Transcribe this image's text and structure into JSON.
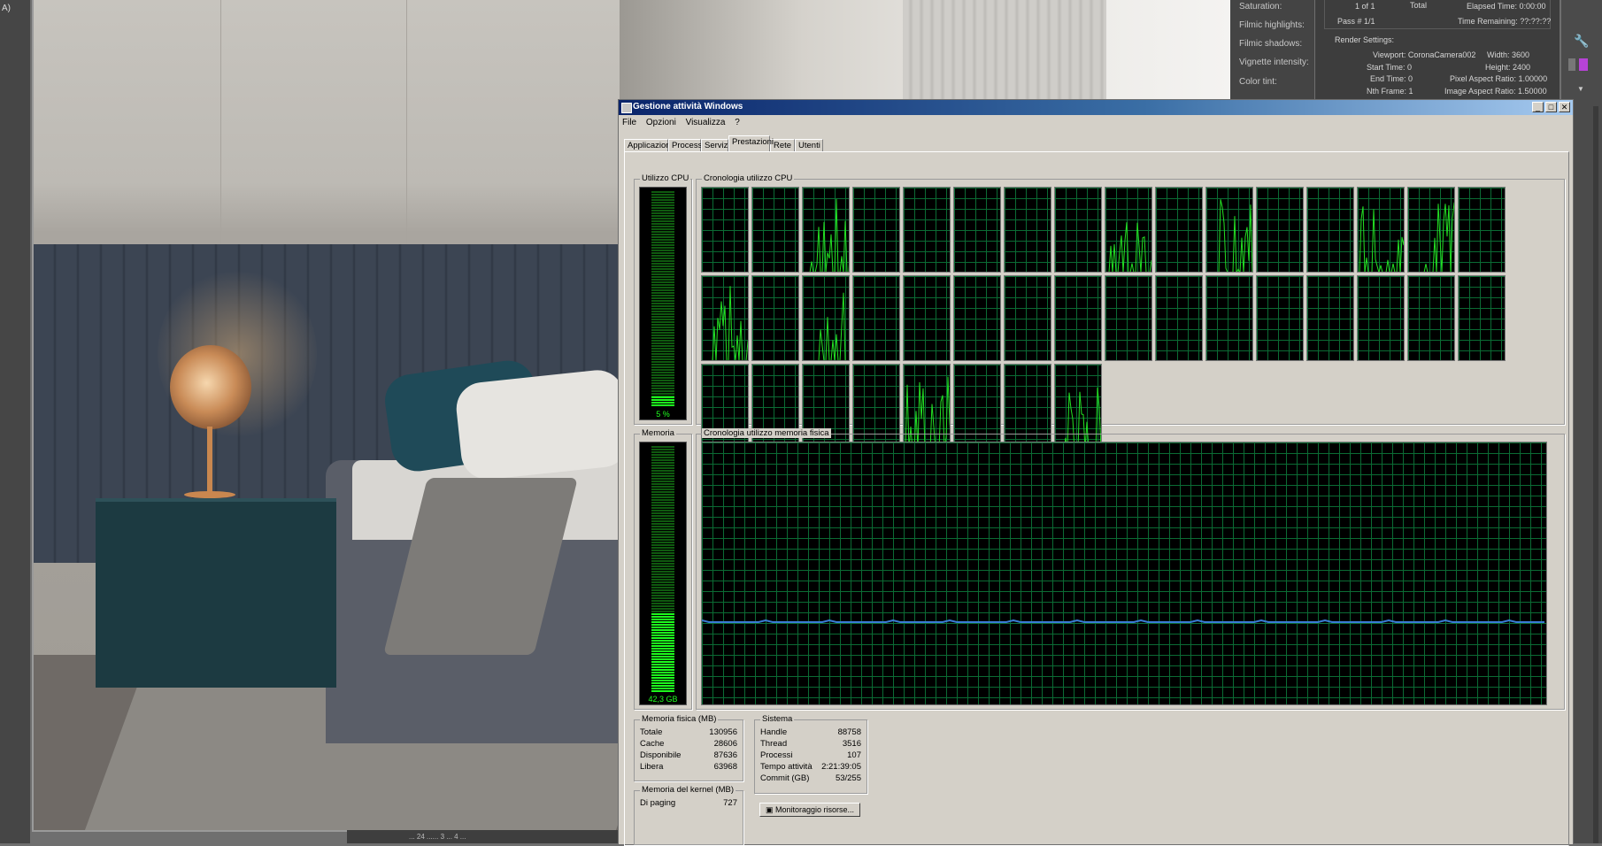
{
  "desktop": {
    "left_strip_label": "A)",
    "bottom_status_text": "... 24 ...... 3 ... 4 ..."
  },
  "corona_panel": {
    "tone_labels": [
      "Saturation:",
      "Filmic highlights:",
      "Filmic shadows:",
      "Vignette intensity:",
      "Color tint:"
    ],
    "pass_info": {
      "pass_count": "1 of 1",
      "total_label": "Total",
      "elapsed": "Elapsed Time:  0:00:00",
      "pass": "Pass #  1/1",
      "remaining": "Time Remaining:  ??:??:??"
    },
    "render_settings_title": "Render Settings:",
    "render_settings": [
      [
        "Viewport: CoronaCamera002",
        "Width: 3600"
      ],
      [
        "Start Time: 0",
        "Height: 2400"
      ],
      [
        "End Time: 0",
        "Pixel Aspect Ratio: 1.00000"
      ],
      [
        "Nth Frame: 1",
        "Image Aspect Ratio: 1.50000"
      ]
    ]
  },
  "taskmgr": {
    "title": "Gestione attività Windows",
    "caption_buttons": [
      "_",
      "□",
      "✕"
    ],
    "menu": [
      "File",
      "Opzioni",
      "Visualizza",
      "?"
    ],
    "tabs": [
      {
        "label": "Applicazioni",
        "active": false
      },
      {
        "label": "Processi",
        "active": false
      },
      {
        "label": "Servizi",
        "active": false
      },
      {
        "label": "Prestazioni",
        "active": true
      },
      {
        "label": "Rete",
        "active": false
      },
      {
        "label": "Utenti",
        "active": false
      }
    ],
    "cpu_usage": {
      "label": "Utilizzo CPU",
      "value_text": "5 %",
      "percent": 5
    },
    "cpu_history_label": "Cronologia utilizzo CPU",
    "cpu_graph_count": 40,
    "cpu_active_graphs": [
      2,
      8,
      10,
      13,
      14,
      16,
      18,
      36,
      39
    ],
    "memory": {
      "label": "Memoria",
      "value_text": "42,3 GB",
      "percent": 32
    },
    "memory_history_label": "Cronologia utilizzo memoria fisica",
    "physical_memory": {
      "title": "Memoria fisica (MB)",
      "rows": [
        [
          "Totale",
          "130956"
        ],
        [
          "Cache",
          "28606"
        ],
        [
          "Disponibile",
          "87636"
        ],
        [
          "Libera",
          "63968"
        ]
      ]
    },
    "system": {
      "title": "Sistema",
      "rows": [
        [
          "Handle",
          "88758"
        ],
        [
          "Thread",
          "3516"
        ],
        [
          "Processi",
          "107"
        ],
        [
          "Tempo attività",
          "2:21:39:05"
        ],
        [
          "Commit (GB)",
          "53/255"
        ]
      ]
    },
    "kernel_memory": {
      "title": "Memoria del kernel (MB)",
      "rows": [
        [
          "Di paging",
          "727"
        ]
      ]
    },
    "resource_monitor_button": "Monitoraggio risorse..."
  },
  "colors": {
    "graph_green": "#23e023",
    "memory_line": "#3a7bd5",
    "title_blue": "#0a246a"
  }
}
